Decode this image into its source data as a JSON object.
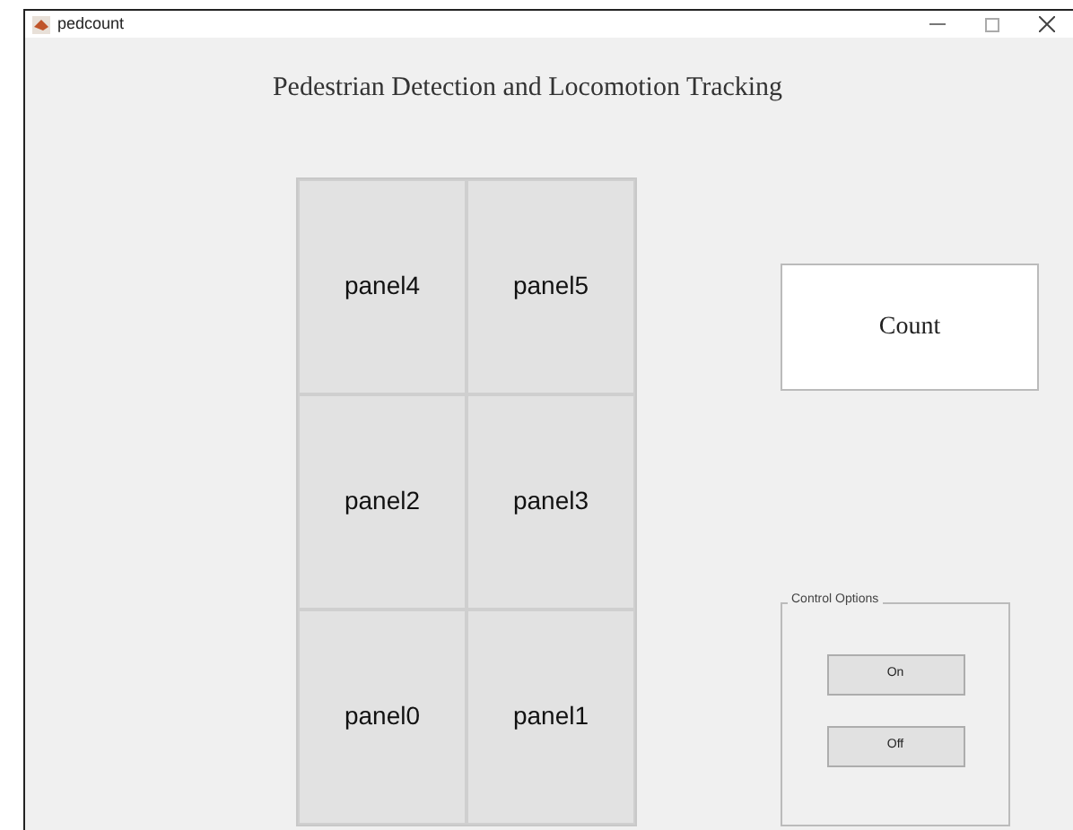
{
  "window": {
    "title": "pedcount"
  },
  "heading": "Pedestrian Detection and Locomotion Tracking",
  "panels": [
    {
      "label": "panel4"
    },
    {
      "label": "panel5"
    },
    {
      "label": "panel2"
    },
    {
      "label": "panel3"
    },
    {
      "label": "panel0"
    },
    {
      "label": "panel1"
    }
  ],
  "count_box": {
    "label": "Count"
  },
  "control_options": {
    "title": "Control Options",
    "buttons": [
      "On",
      "Off"
    ]
  }
}
